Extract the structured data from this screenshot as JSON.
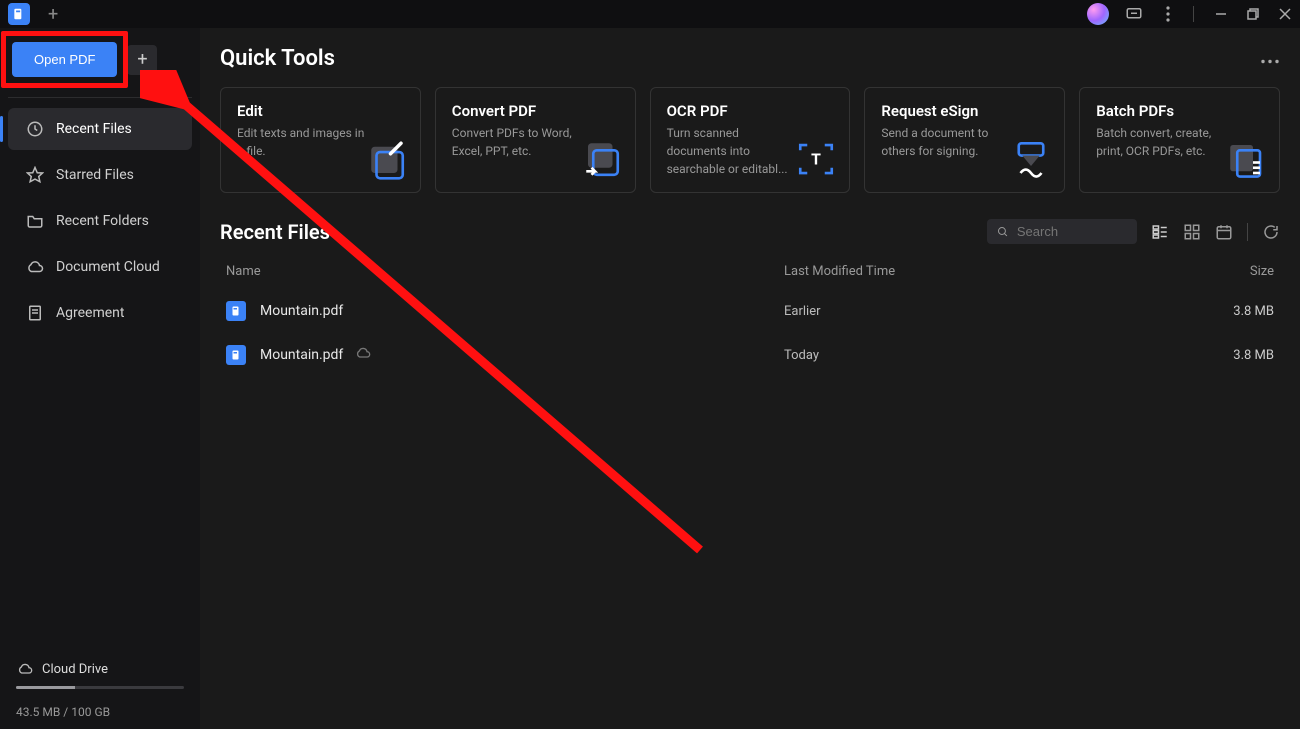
{
  "titlebar": {
    "new_tab_icon": "+"
  },
  "sidebar": {
    "open_pdf_label": "Open PDF",
    "plus_icon": "+",
    "nav": [
      {
        "label": "Recent Files"
      },
      {
        "label": "Starred Files"
      },
      {
        "label": "Recent Folders"
      },
      {
        "label": "Document Cloud"
      },
      {
        "label": "Agreement"
      }
    ],
    "cloud_drive_label": "Cloud Drive",
    "storage_text": "43.5 MB / 100 GB"
  },
  "quick_tools": {
    "title": "Quick Tools",
    "cards": [
      {
        "title": "Edit",
        "desc": "Edit texts and images in a file."
      },
      {
        "title": "Convert PDF",
        "desc": "Convert PDFs to Word, Excel, PPT, etc."
      },
      {
        "title": "OCR PDF",
        "desc": "Turn scanned documents into searchable or editabl..."
      },
      {
        "title": "Request eSign",
        "desc": "Send a document to others for signing."
      },
      {
        "title": "Batch PDFs",
        "desc": "Batch convert, create, print, OCR PDFs, etc."
      }
    ]
  },
  "recent_files": {
    "title": "Recent Files",
    "search_placeholder": "Search",
    "columns": {
      "name": "Name",
      "time": "Last Modified Time",
      "size": "Size"
    },
    "rows": [
      {
        "name": "Mountain.pdf",
        "time": "Earlier",
        "size": "3.8 MB",
        "cloud": false
      },
      {
        "name": "Mountain.pdf",
        "time": "Today",
        "size": "3.8 MB",
        "cloud": true
      }
    ]
  }
}
